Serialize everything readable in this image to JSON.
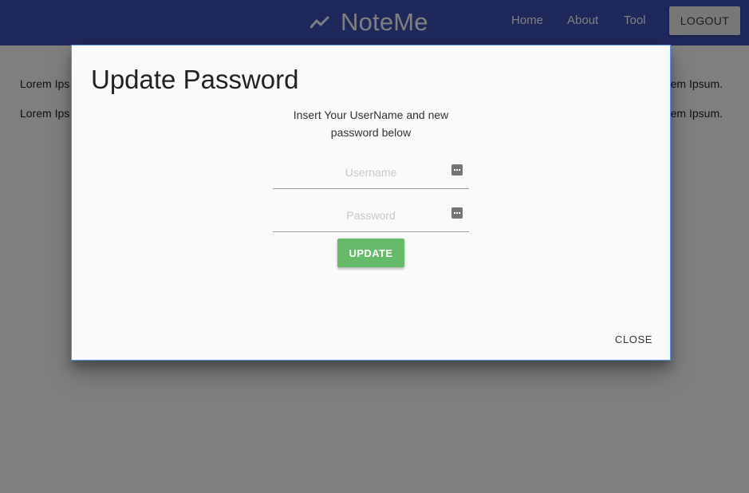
{
  "navbar": {
    "brand": "NoteMe",
    "brand_icon": "trending-up-icon",
    "links": [
      "Home",
      "About",
      "Tool"
    ],
    "logout_label": "LOGOUT",
    "bg_color": "#3f51b5"
  },
  "page": {
    "lines": [
      {
        "start": "Lorem Ips",
        "end": "em Ipsum."
      },
      {
        "start": "Lorem Ips",
        "end": "em Ipsum."
      }
    ]
  },
  "modal": {
    "title": "Update Password",
    "instructions": "Insert Your UserName and new password below",
    "username": {
      "value": "",
      "placeholder": "Username",
      "icon": "password-icon"
    },
    "password": {
      "value": "",
      "placeholder": "Password",
      "icon": "password-icon"
    },
    "update_label": "UPDATE",
    "close_label": "CLOSE",
    "update_color": "#66bb6a"
  }
}
